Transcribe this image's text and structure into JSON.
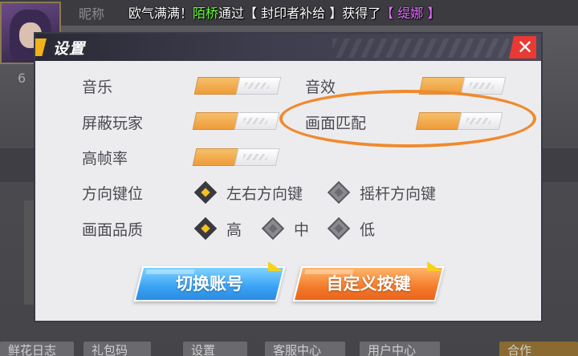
{
  "background": {
    "player_name": "昵称",
    "player_level": "6",
    "badge": "",
    "bottom_tabs": [
      "鲜花日志",
      "礼包码",
      "设置",
      "客服中心",
      "用户中心",
      "合作"
    ]
  },
  "ticker": {
    "prefix": "欧气满满！",
    "player": "陌桥",
    "middle": "通过【 封印者补给 】获得了",
    "reward": "【 缇娜 】"
  },
  "dialog": {
    "title": "设置",
    "close_label": "✕",
    "toggles": [
      {
        "label": "音乐",
        "on": true
      },
      {
        "label": "音效",
        "on": true
      },
      {
        "label": "屏蔽玩家",
        "on": true
      },
      {
        "label": "画面匹配",
        "on": true
      },
      {
        "label": "高帧率",
        "on": true
      }
    ],
    "direction": {
      "label": "方向键位",
      "options": [
        "左右方向键",
        "摇杆方向键"
      ],
      "selected": "左右方向键"
    },
    "quality": {
      "label": "画面品质",
      "options": [
        "高",
        "中",
        "低"
      ],
      "selected": "高"
    },
    "buttons": {
      "switch_account": "切换账号",
      "custom_keys": "自定义按键"
    }
  },
  "colors": {
    "toggle_on": "#ef9b3a",
    "close": "#e83a33",
    "button_blue": "#3aa2f4",
    "button_orange": "#f57b2a",
    "radio_selected": "#f7c21a",
    "annotation": "#f08a2e"
  }
}
